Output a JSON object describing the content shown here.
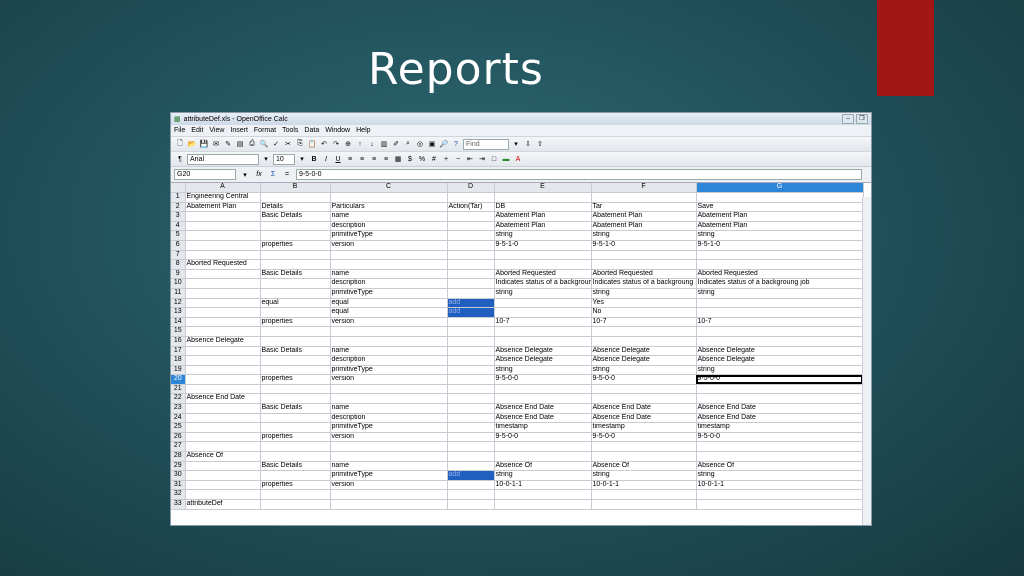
{
  "slide": {
    "title": "Reports"
  },
  "window": {
    "title": "attributeDef.xls - OpenOffice Calc"
  },
  "menu": [
    "File",
    "Edit",
    "View",
    "Insert",
    "Format",
    "Tools",
    "Data",
    "Window",
    "Help"
  ],
  "toolbar": {
    "find_placeholder": "Find",
    "font_name": "Arial",
    "font_size": "10",
    "bold": "B",
    "italic": "I",
    "underline": "U"
  },
  "formula": {
    "cell_ref": "G20",
    "fx": "fx",
    "sum": "Σ",
    "eq": "=",
    "value": "9-5-0-0"
  },
  "columns": [
    "A",
    "B",
    "C",
    "D",
    "E",
    "F",
    "G"
  ],
  "rows": [
    [
      "1",
      "Engineering Central",
      "",
      "",
      "",
      "",
      "",
      ""
    ],
    [
      "2",
      "Abatement Plan",
      "Details",
      "Particulars",
      "Action(Tar)",
      "DB",
      "Tar",
      "Save"
    ],
    [
      "3",
      "",
      "Basic Details",
      "name",
      "",
      "Abatement Plan",
      "Abatement Plan",
      "Abatement Plan"
    ],
    [
      "4",
      "",
      "",
      "description",
      "",
      "Abatement Plan",
      "Abatement Plan",
      "Abatement Plan"
    ],
    [
      "5",
      "",
      "",
      "primitiveType",
      "",
      "string",
      "string",
      "string"
    ],
    [
      "6",
      "",
      "properties",
      "version",
      "",
      "9-5-1-0",
      "9-5-1-0",
      "9-5-1-0"
    ],
    [
      "7",
      "",
      "",
      "",
      "",
      "",
      "",
      ""
    ],
    [
      "8",
      "Aborted Requested",
      "",
      "",
      "",
      "",
      "",
      ""
    ],
    [
      "9",
      "",
      "Basic Details",
      "name",
      "",
      "Aborted Requested",
      "Aborted Requested",
      "Aborted Requested"
    ],
    [
      "10",
      "",
      "",
      "description",
      "",
      "Indicates status of a backgrour",
      "Indicates status of a backgroung",
      "Indicates status of a backgroung job"
    ],
    [
      "11",
      "",
      "",
      "primitiveType",
      "",
      "string",
      "string",
      "string"
    ],
    [
      "12",
      "",
      "equal",
      "equal",
      "add",
      "",
      "Yes",
      ""
    ],
    [
      "13",
      "",
      "",
      "equal",
      "add",
      "",
      "No",
      ""
    ],
    [
      "14",
      "",
      "properties",
      "version",
      "",
      "10-7",
      "10-7",
      "10-7"
    ],
    [
      "15",
      "",
      "",
      "",
      "",
      "",
      "",
      ""
    ],
    [
      "16",
      "Absence Delegate",
      "",
      "",
      "",
      "",
      "",
      ""
    ],
    [
      "17",
      "",
      "Basic Details",
      "name",
      "",
      "Absence Delegate",
      "Absence Delegate",
      "Absence Delegate"
    ],
    [
      "18",
      "",
      "",
      "description",
      "",
      "Absence Delegate",
      "Absence Delegate",
      "Absence Delegate"
    ],
    [
      "19",
      "",
      "",
      "primitiveType",
      "",
      "string",
      "string",
      "string"
    ],
    [
      "20",
      "",
      "properties",
      "version",
      "",
      "9-5-0-0",
      "9-5-0-0",
      "9-5-0-0"
    ],
    [
      "21",
      "",
      "",
      "",
      "",
      "",
      "",
      ""
    ],
    [
      "22",
      "Absence End Date",
      "",
      "",
      "",
      "",
      "",
      ""
    ],
    [
      "23",
      "",
      "Basic Details",
      "name",
      "",
      "Absence End Date",
      "Absence End Date",
      "Absence End Date"
    ],
    [
      "24",
      "",
      "",
      "description",
      "",
      "Absence End Date",
      "Absence End Date",
      "Absence End Date"
    ],
    [
      "25",
      "",
      "",
      "primitiveType",
      "",
      "timestamp",
      "timestamp",
      "timestamp"
    ],
    [
      "26",
      "",
      "properties",
      "version",
      "",
      "9-5-0-0",
      "9-5-0-0",
      "9-5-0-0"
    ],
    [
      "27",
      "",
      "",
      "",
      "",
      "",
      "",
      ""
    ],
    [
      "28",
      "Absence Of",
      "",
      "",
      "",
      "",
      "",
      ""
    ],
    [
      "29",
      "",
      "Basic Details",
      "name",
      "",
      "Absence Of",
      "Absence Of",
      "Absence Of"
    ],
    [
      "30",
      "",
      "",
      "primitiveType",
      "add",
      "string",
      "string",
      "string"
    ],
    [
      "31",
      "",
      "properties",
      "version",
      "",
      "10-0-1-1",
      "10-0-1-1",
      "10-0-1-1"
    ],
    [
      "32",
      "",
      "",
      "",
      "",
      "",
      "",
      ""
    ],
    [
      "33",
      "attributeDef",
      "",
      "",
      "",
      "",
      "",
      ""
    ]
  ],
  "colors": {
    "accent": "#a31616",
    "selection": "#2e86d9",
    "action_fill": "#1f5fc0"
  }
}
